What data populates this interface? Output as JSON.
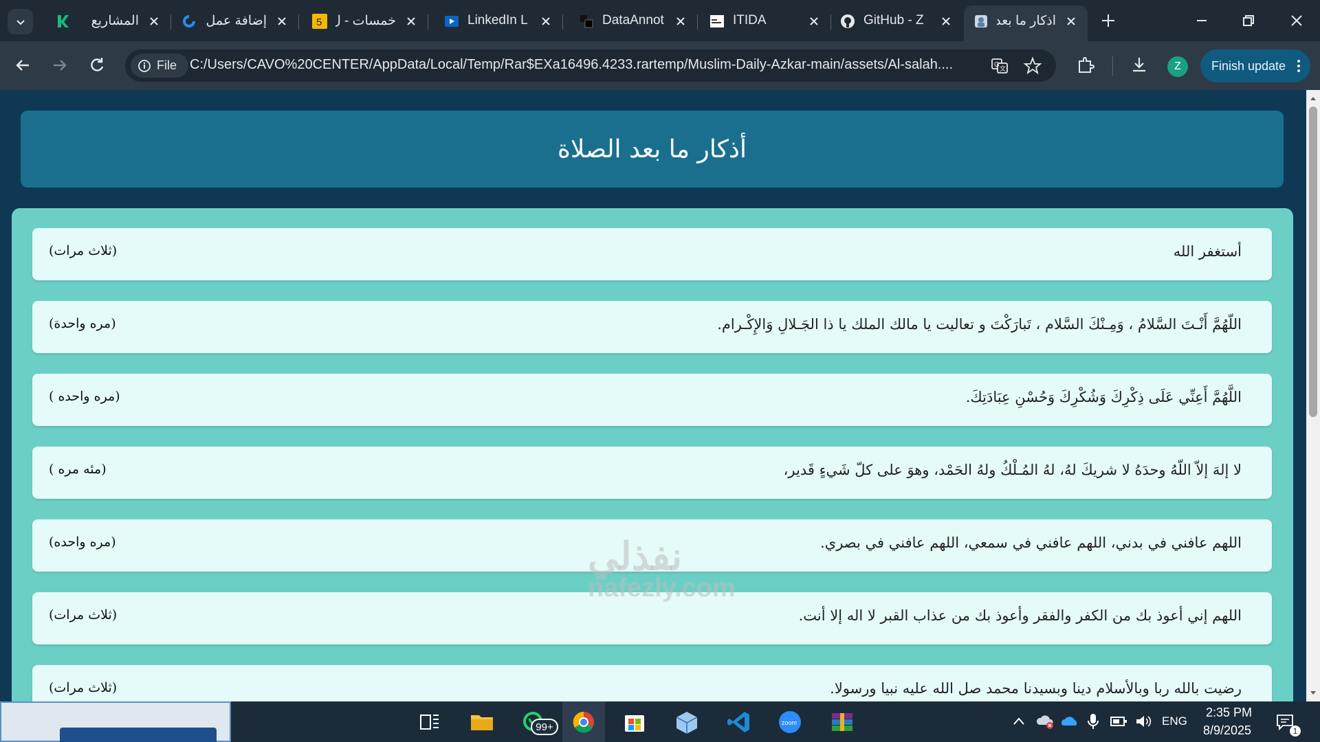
{
  "browser": {
    "tabs": [
      {
        "title": "المشاريع",
        "icon": "khamsat-k-icon",
        "rtl": true
      },
      {
        "title": "إضافة عمل",
        "icon": "mostaql-icon",
        "rtl": true
      },
      {
        "title": "خمسات - ل",
        "icon": "khamsat-5-icon",
        "rtl": true
      },
      {
        "title": "LinkedIn L",
        "icon": "linkedin-learning-icon",
        "rtl": false
      },
      {
        "title": "DataAnnot",
        "icon": "dataannotation-icon",
        "rtl": false
      },
      {
        "title": "ITIDA",
        "icon": "itida-icon",
        "rtl": false
      },
      {
        "title": "GitHub - Z",
        "icon": "github-icon",
        "rtl": false
      },
      {
        "title": "اذكار ما بعد",
        "icon": "page-favicon-icon",
        "rtl": true,
        "active": true
      }
    ],
    "site_chip": "File",
    "url": "C:/Users/CAVO%20CENTER/AppData/Local/Temp/Rar$EXa16496.4233.rartemp/Muslim-Daily-Azkar-main/assets/Al-salah....",
    "avatar_letter": "Z",
    "finish_update_label": "Finish update",
    "accent_color": "#0f5a7e"
  },
  "page": {
    "title": "أذكار ما بعد الصلاة",
    "azkar": [
      {
        "text": "أستغفر الله",
        "count": "(ثلاث مرات)"
      },
      {
        "text": "اللّهُمَّ أَنْـتَ السَّلامُ ، وَمِـنْكَ السَّلام ، تَبارَكْتَ و تعاليت يا مالك الملك يا ذا الجَـلالِ وَالإِكْـرام.",
        "count": "(مره واحدة)"
      },
      {
        "text": "اللَّهُمَّ أَعِنِّي عَلَى ذِكْرِكَ وَشُكْرِكَ وَحُسْنِ عِبَادَتِكَ.",
        "count": "(مره واحده )"
      },
      {
        "text": "لا إلهَ إلاّ اللّهُ وحدَهُ لا شريكَ لهُ، لهُ المُـلْكُ ولهُ الحَمْد، وهوَ على كلّ شَيءٍ قَدير،",
        "count": "(مئه مره )"
      },
      {
        "text": "اللهم عافني في بدني، اللهم عافني في سمعي، اللهم عافني في بصري.",
        "count": "(مره واحده)"
      },
      {
        "text": "اللهم إني أعوذ بك من الكفر والفقر وأعوذ بك من عذاب القبر لا اله إلا أنت.",
        "count": "(ثلاث مرات)"
      },
      {
        "text": "رضيت بالله ربا وبالأسلام دينا وبسيدنا محمد صل الله عليه نبيا ورسولا.",
        "count": "(ثلاث مرات)"
      }
    ],
    "colors": {
      "background": "#0e3854",
      "header": "#1a6f8e",
      "panel": "#6ccfc6",
      "card": "#e4fbfa"
    }
  },
  "watermark": {
    "arabic": "نفذلي",
    "latin": "nafezly.com"
  },
  "taskbar": {
    "whatsapp_badge": "99+",
    "language": "ENG",
    "time": "2:35 PM",
    "date": "8/9/2025",
    "notification_count": "1"
  }
}
